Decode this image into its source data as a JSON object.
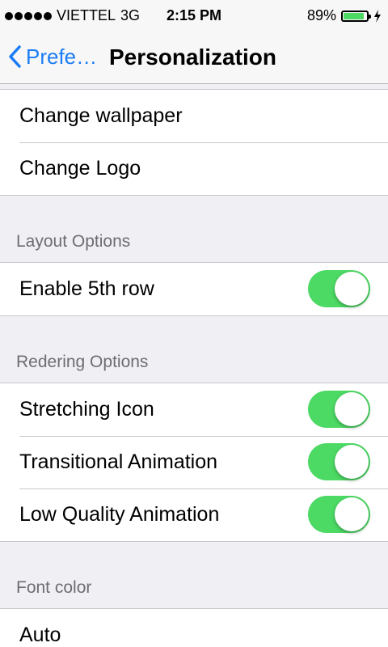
{
  "status_bar": {
    "carrier": "VIETTEL",
    "network": "3G",
    "time": "2:15 PM",
    "battery_percent": "89%",
    "battery_level": 0.89
  },
  "nav": {
    "back_label": "Prefe…",
    "title": "Personalization"
  },
  "groups": {
    "top": {
      "change_wallpaper": "Change wallpaper",
      "change_logo": "Change Logo"
    },
    "layout": {
      "header": "Layout Options",
      "enable_5th_row": {
        "label": "Enable 5th row",
        "on": true
      }
    },
    "rendering": {
      "header": "Redering Options",
      "stretching_icon": {
        "label": "Stretching Icon",
        "on": true
      },
      "transitional_animation": {
        "label": "Transitional Animation",
        "on": true
      },
      "low_quality_animation": {
        "label": "Low Quality Animation",
        "on": true
      }
    },
    "font_color": {
      "header": "Font color",
      "auto": "Auto"
    }
  },
  "colors": {
    "accent": "#1a7cf4",
    "toggle_on": "#4cd964",
    "background": "#efeff4"
  }
}
